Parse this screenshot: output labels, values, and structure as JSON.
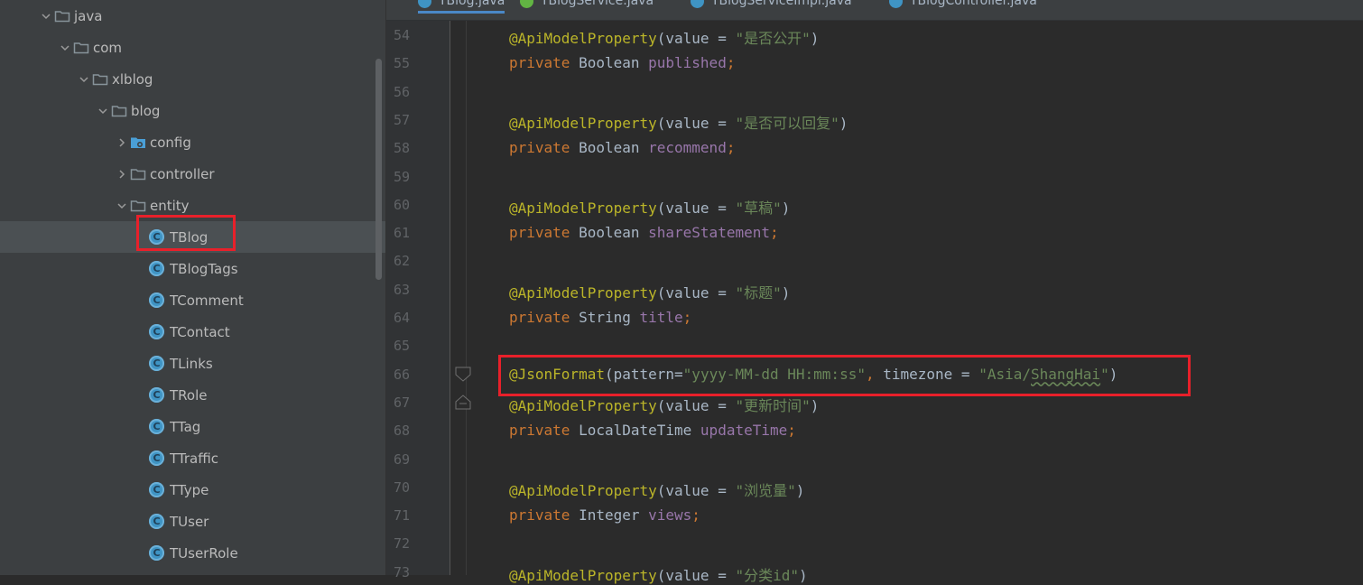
{
  "project_tree": {
    "items": [
      {
        "label": "java",
        "kind": "folder",
        "expanded": true
      },
      {
        "label": "com",
        "kind": "folder",
        "expanded": true
      },
      {
        "label": "xlblog",
        "kind": "folder",
        "expanded": true
      },
      {
        "label": "blog",
        "kind": "folder",
        "expanded": true
      },
      {
        "label": "config",
        "kind": "config-folder",
        "expanded": false
      },
      {
        "label": "controller",
        "kind": "folder",
        "expanded": false
      },
      {
        "label": "entity",
        "kind": "folder",
        "expanded": true
      },
      {
        "label": "TBlog",
        "kind": "class",
        "selected": true
      },
      {
        "label": "TBlogTags",
        "kind": "class"
      },
      {
        "label": "TComment",
        "kind": "class"
      },
      {
        "label": "TContact",
        "kind": "class"
      },
      {
        "label": "TLinks",
        "kind": "class"
      },
      {
        "label": "TRole",
        "kind": "class"
      },
      {
        "label": "TTag",
        "kind": "class"
      },
      {
        "label": "TTraffic",
        "kind": "class"
      },
      {
        "label": "TType",
        "kind": "class"
      },
      {
        "label": "TUser",
        "kind": "class"
      },
      {
        "label": "TUserRole",
        "kind": "class"
      }
    ],
    "class_icon_letter": "C"
  },
  "tabs": [
    {
      "label": "TBlog.java",
      "icon": "class-icon",
      "active": true
    },
    {
      "label": "TBlogService.java",
      "icon": "interface-icon",
      "active": false
    },
    {
      "label": "TBlogServiceImpl.java",
      "icon": "class-icon",
      "active": false
    },
    {
      "label": "TBlogController.java",
      "icon": "class-icon",
      "active": false
    }
  ],
  "editor": {
    "lines": [
      {
        "num": "54",
        "tokens": [
          [
            "ann",
            "@ApiModelProperty"
          ],
          [
            "txt",
            "(value = "
          ],
          [
            "str",
            "\"是否公开\""
          ],
          [
            "txt",
            ")"
          ]
        ]
      },
      {
        "num": "55",
        "tokens": [
          [
            "kw",
            "private "
          ],
          [
            "txt",
            "Boolean "
          ],
          [
            "fld",
            "published"
          ],
          [
            "kw",
            ";"
          ]
        ]
      },
      {
        "num": "56",
        "tokens": []
      },
      {
        "num": "57",
        "tokens": [
          [
            "ann",
            "@ApiModelProperty"
          ],
          [
            "txt",
            "(value = "
          ],
          [
            "str",
            "\"是否可以回复\""
          ],
          [
            "txt",
            ")"
          ]
        ]
      },
      {
        "num": "58",
        "tokens": [
          [
            "kw",
            "private "
          ],
          [
            "txt",
            "Boolean "
          ],
          [
            "fld",
            "recommend"
          ],
          [
            "kw",
            ";"
          ]
        ]
      },
      {
        "num": "59",
        "tokens": []
      },
      {
        "num": "60",
        "tokens": [
          [
            "ann",
            "@ApiModelProperty"
          ],
          [
            "txt",
            "(value = "
          ],
          [
            "str",
            "\"草稿\""
          ],
          [
            "txt",
            ")"
          ]
        ]
      },
      {
        "num": "61",
        "tokens": [
          [
            "kw",
            "private "
          ],
          [
            "txt",
            "Boolean "
          ],
          [
            "fld",
            "shareStatement"
          ],
          [
            "kw",
            ";"
          ]
        ]
      },
      {
        "num": "62",
        "tokens": []
      },
      {
        "num": "63",
        "tokens": [
          [
            "ann",
            "@ApiModelProperty"
          ],
          [
            "txt",
            "(value = "
          ],
          [
            "str",
            "\"标题\""
          ],
          [
            "txt",
            ")"
          ]
        ]
      },
      {
        "num": "64",
        "tokens": [
          [
            "kw",
            "private "
          ],
          [
            "txt",
            "String "
          ],
          [
            "fld",
            "title"
          ],
          [
            "kw",
            ";"
          ]
        ]
      },
      {
        "num": "65",
        "tokens": []
      },
      {
        "num": "66",
        "tokens": [
          [
            "ann",
            "@JsonFormat"
          ],
          [
            "txt",
            "(pattern="
          ],
          [
            "str",
            "\"yyyy-MM-dd HH:mm:ss\""
          ],
          [
            "kw",
            ", "
          ],
          [
            "txt",
            "timezone = "
          ],
          [
            "str",
            "\"Asia/"
          ],
          [
            "typo",
            "ShangHai"
          ],
          [
            "str",
            "\""
          ],
          [
            "txt",
            ")"
          ]
        ]
      },
      {
        "num": "67",
        "tokens": [
          [
            "ann",
            "@ApiModelProperty"
          ],
          [
            "txt",
            "(value = "
          ],
          [
            "str",
            "\"更新时间\""
          ],
          [
            "txt",
            ")"
          ]
        ]
      },
      {
        "num": "68",
        "tokens": [
          [
            "kw",
            "private "
          ],
          [
            "txt",
            "LocalDateTime "
          ],
          [
            "fld",
            "updateTime"
          ],
          [
            "kw",
            ";"
          ]
        ]
      },
      {
        "num": "69",
        "tokens": []
      },
      {
        "num": "70",
        "tokens": [
          [
            "ann",
            "@ApiModelProperty"
          ],
          [
            "txt",
            "(value = "
          ],
          [
            "str",
            "\"浏览量\""
          ],
          [
            "txt",
            ")"
          ]
        ]
      },
      {
        "num": "71",
        "tokens": [
          [
            "kw",
            "private "
          ],
          [
            "txt",
            "Integer "
          ],
          [
            "fld",
            "views"
          ],
          [
            "kw",
            ";"
          ]
        ]
      },
      {
        "num": "72",
        "tokens": []
      },
      {
        "num": "73",
        "tokens": [
          [
            "ann",
            "@ApiModelProperty"
          ],
          [
            "txt",
            "(value = "
          ],
          [
            "str",
            "\"分类id\""
          ],
          [
            "txt",
            ")"
          ]
        ]
      }
    ]
  },
  "colors": {
    "highlight": "#e8202a",
    "annotation": "#bbb529",
    "keyword": "#cc7832",
    "string": "#6a8759",
    "field": "#9876aa",
    "folder": "#87939a",
    "config_folder": "#4a9fd6"
  }
}
